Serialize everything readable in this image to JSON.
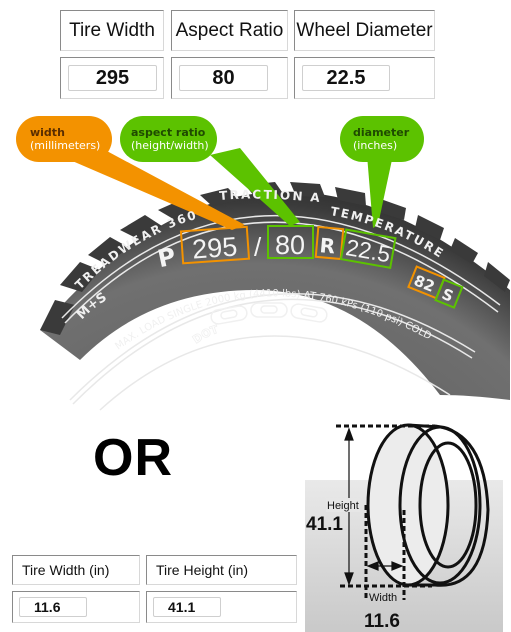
{
  "top_calculator": {
    "headers": [
      "Tire Width",
      "Aspect Ratio",
      "Wheel Diameter"
    ],
    "values": [
      "295",
      "80",
      "22.5"
    ]
  },
  "callouts": {
    "width": {
      "title": "width",
      "subtitle": "(millimeters)",
      "color": "#f39200"
    },
    "aspect_ratio": {
      "title": "aspect ratio",
      "subtitle": "(height/width)",
      "color": "#5cc200"
    },
    "diameter": {
      "title": "diameter",
      "subtitle": "(inches)",
      "color": "#5cc200"
    }
  },
  "sidewall": {
    "treadwear": "TREADWEAR 360",
    "traction": "TRACTION A",
    "temperature": "TEMPERATURE",
    "type_letter": "P",
    "width": "295",
    "slash": "/",
    "aspect": "80",
    "construction": "R",
    "diameter": "22.5",
    "load_index": "82",
    "speed_rating": "S",
    "mud_snow": "M+S",
    "max_load": "MAX. LOAD SINGLE 2000 kg (4410 lbs) AT 760 kPs (110 psi) COLD",
    "dot": "DOT"
  },
  "or_label": "OR",
  "bottom_calculator": {
    "headers": [
      "Tire Width (in)",
      "Tire Height (in)"
    ],
    "values": [
      "11.6",
      "41.1"
    ]
  },
  "diagram": {
    "height_label": "Height",
    "height_value": "41.1",
    "width_label": "Width",
    "width_value": "11.6"
  }
}
